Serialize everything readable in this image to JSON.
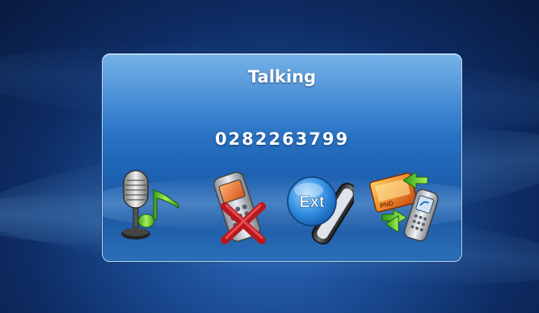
{
  "dialog": {
    "title": "Talking",
    "number": "0282263799"
  },
  "actions": [
    {
      "id": "voice",
      "icon": "microphone-music-note-icon"
    },
    {
      "id": "hangup",
      "icon": "phone-cancel-icon"
    },
    {
      "id": "extension",
      "icon": "ext-keypad-icon",
      "badge": "Ext"
    },
    {
      "id": "transfer",
      "icon": "phone-transfer-icon",
      "badge": "PND"
    }
  ]
}
